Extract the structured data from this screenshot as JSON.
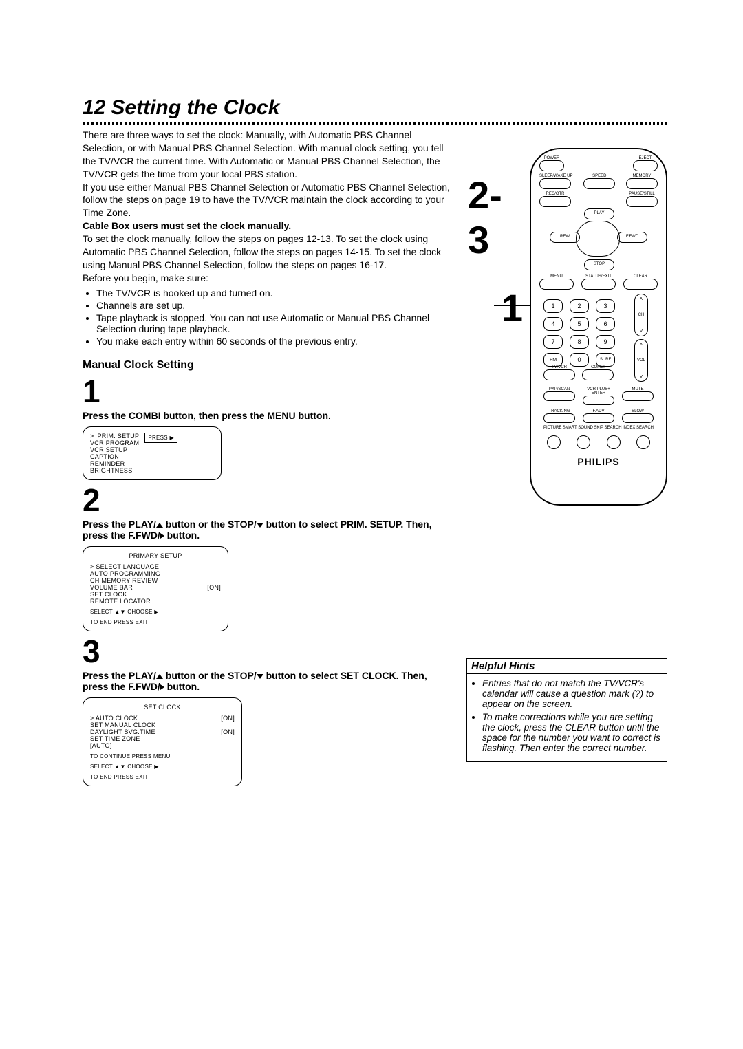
{
  "page": {
    "number": "12",
    "title": "Setting the Clock"
  },
  "intro": {
    "p1": "There are three ways to set the clock: Manually, with Automatic PBS Channel Selection, or with Manual PBS Channel Selection. With manual clock setting, you tell the TV/VCR the current time. With Automatic or Manual PBS Channel Selection, the TV/VCR gets the time from your local PBS station.",
    "p2": "If you use either Manual PBS Channel Selection or Automatic PBS Channel Selection, follow the steps on page 19 to have the TV/VCR maintain the clock according to your Time Zone.",
    "bold1": "Cable Box users must set the clock manually.",
    "p3": "To set the clock manually, follow the steps on pages 12-13. To set the clock using Automatic PBS Channel Selection, follow the steps on pages 14-15. To set the clock using Manual PBS Channel Selection, follow the steps on pages 16-17.",
    "before": "Before you begin, make sure:",
    "bullets": [
      "The TV/VCR is hooked up and turned on.",
      "Channels are set up.",
      "Tape playback is stopped. You can not use Automatic or Manual PBS Channel Selection during tape playback.",
      "You make each entry within 60 seconds of the previous entry."
    ]
  },
  "section": {
    "title": "Manual Clock Setting"
  },
  "steps": {
    "s1": {
      "n": "1",
      "text": "Press the COMBI button, then press the MENU button."
    },
    "s2": {
      "n": "2",
      "text_a": "Press the PLAY/",
      "text_b": " button or the STOP/",
      "text_c": " button to select PRIM. SETUP.  Then, press the F.FWD/",
      "text_d": " button."
    },
    "s3": {
      "n": "3",
      "text_a": "Press the PLAY/",
      "text_b": " button or the STOP/",
      "text_c": " button to select SET CLOCK. Then, press the F.FWD/",
      "text_d": " button."
    }
  },
  "osd1": {
    "items": [
      "PRIM. SETUP",
      "VCR PROGRAM",
      "VCR SETUP",
      "CAPTION",
      "REMINDER",
      "BRIGHTNESS"
    ],
    "marker": ">",
    "press": "PRESS ▶"
  },
  "osd2": {
    "title": "PRIMARY SETUP",
    "rows": [
      {
        "l": "SELECT LANGUAGE",
        "r": ""
      },
      {
        "l": "AUTO PROGRAMMING",
        "r": ""
      },
      {
        "l": "CH MEMORY REVIEW",
        "r": ""
      },
      {
        "l": "VOLUME BAR",
        "r": "[ON]"
      },
      {
        "l": "SET CLOCK",
        "r": ""
      },
      {
        "l": "REMOTE LOCATOR",
        "r": ""
      }
    ],
    "foot1": "SELECT ▲▼ CHOOSE ▶",
    "foot2": "TO  END  PRESS  EXIT"
  },
  "osd3": {
    "title": "SET CLOCK",
    "rows": [
      {
        "l": "AUTO CLOCK",
        "r": "[ON]"
      },
      {
        "l": "SET MANUAL CLOCK",
        "r": ""
      },
      {
        "l": "DAYLIGHT SVG.TIME",
        "r": "[ON]"
      },
      {
        "l": "SET TIME ZONE",
        "r": ""
      },
      {
        "l": "   [AUTO]",
        "r": ""
      }
    ],
    "foot0": "TO CONTINUE PRESS MENU",
    "foot1": "SELECT ▲▼ CHOOSE ▶",
    "foot2": "TO  END  PRESS  EXIT"
  },
  "callouts": {
    "big1": "1",
    "big23": "2-3"
  },
  "remote": {
    "labels": {
      "power": "POWER",
      "eject": "EJECT",
      "sleep": "SLEEP/WAKE UP",
      "speed": "SPEED",
      "memory": "MEMORY",
      "rec": "REC/OTR",
      "pause": "PAUSE/STILL",
      "play": "PLAY",
      "stop": "STOP",
      "rew": "REW",
      "fwd": "F.FWD",
      "menu": "MENU",
      "status": "STATUS/EXIT",
      "clear": "CLEAR",
      "ch": "CH",
      "vol": "VOL",
      "fm": "FM",
      "zero": "0",
      "surf": "SURF",
      "tvvcr": "TV/VCR",
      "combi": "COMBI",
      "pxp": "PXP/SCAN",
      "vcrplus": "VCR PLUS+",
      "enter": "ENTER",
      "mute": "MUTE",
      "tracking": "TRACKING",
      "fadv": "F.ADV",
      "slow": "SLOW",
      "picture": "PICTURE",
      "sound": "SMART SOUND",
      "skip": "SKIP SEARCH",
      "index": "INDEX SEARCH"
    },
    "nums": [
      "1",
      "2",
      "3",
      "4",
      "5",
      "6",
      "7",
      "8",
      "9"
    ],
    "brand": "PHILIPS"
  },
  "hints": {
    "title": "Helpful Hints",
    "items": [
      "Entries that do not match the TV/VCR's calendar will cause a question mark (?) to appear on the screen.",
      "To make corrections while you are setting the clock, press the CLEAR button until the space for the number you want to correct is flashing. Then enter the correct number."
    ]
  }
}
